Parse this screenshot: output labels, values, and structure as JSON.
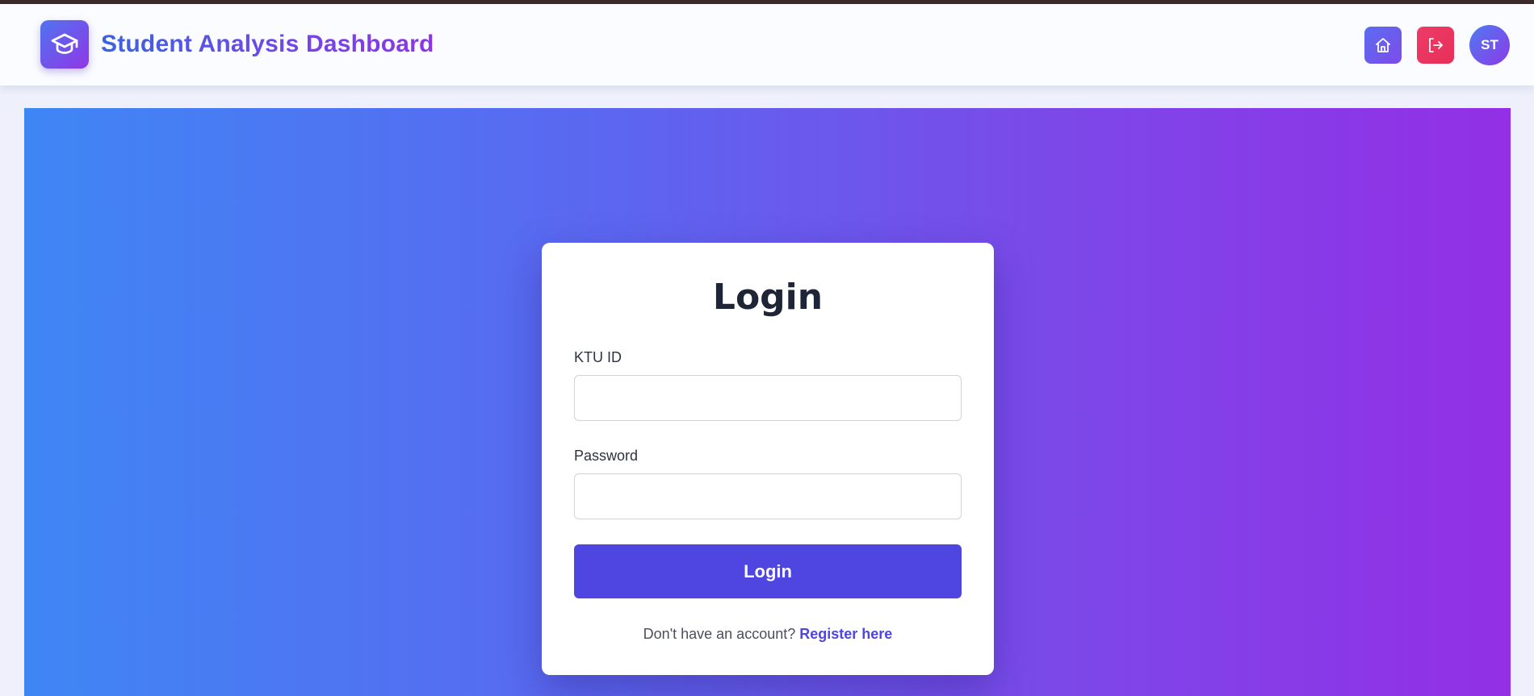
{
  "header": {
    "app_title": "Student Analysis Dashboard",
    "logo_icon": "graduation-cap-icon",
    "home_icon": "home-icon",
    "logout_icon": "logout-icon",
    "avatar_initials": "ST"
  },
  "login": {
    "title": "Login",
    "ktu_id_label": "KTU ID",
    "ktu_id_value": "",
    "password_label": "Password",
    "password_value": "",
    "submit_label": "Login",
    "register_prompt": "Don't have an account?",
    "register_link": "Register here"
  },
  "colors": {
    "accent": "#4f46e1",
    "hero_gradient_start": "#3f86f5",
    "hero_gradient_end": "#932fe6",
    "logout_red": "#e6305a"
  }
}
